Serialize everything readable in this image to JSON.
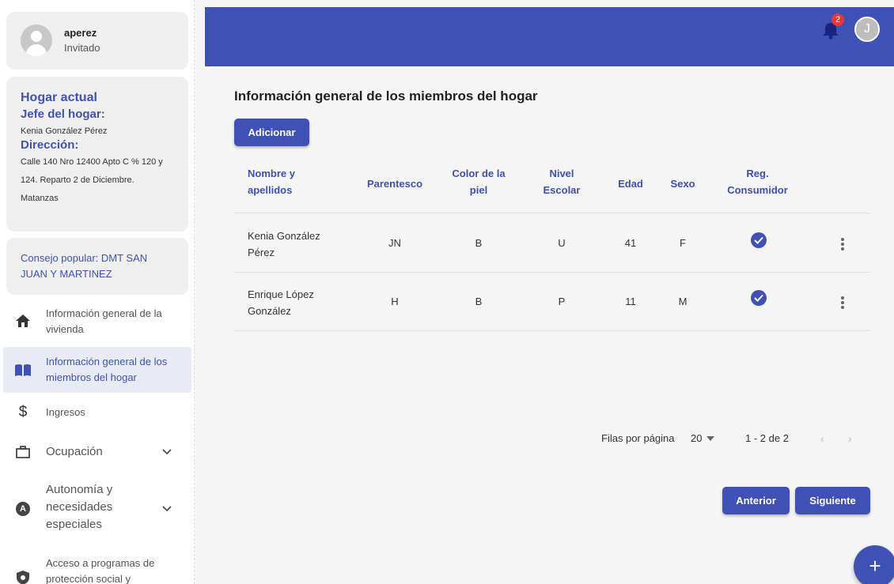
{
  "user": {
    "name": "aperez",
    "role": "Invitado"
  },
  "home": {
    "title": "Hogar actual",
    "jefe_label": "Jefe del hogar:",
    "jefe_value": "Kenia González Pérez",
    "direccion_label": "Dirección:",
    "direccion_line1": "Calle 140 Nro 12400 Apto C % 120 y",
    "direccion_line2": "124. Reparto 2 de Diciembre.",
    "direccion_line3": "Matanzas"
  },
  "consejo": {
    "line1": "Consejo popular: DMT SAN",
    "line2": "JUAN Y MARTINEZ"
  },
  "nav": {
    "vivienda": {
      "line1": "Información general de la",
      "line2": "vivienda"
    },
    "miembros": {
      "line1": "Información general de los",
      "line2": "miembros del hogar"
    },
    "ingresos": "Ingresos",
    "ocupacion": "Ocupación",
    "autonomia": {
      "line1": "Autonomía y",
      "line2": "necesidades",
      "line3": "especiales"
    },
    "acceso": {
      "line1": "Acceso a programas de",
      "line2": "protección social y"
    }
  },
  "header": {
    "notifications": "2",
    "avatar_letter": "J"
  },
  "main": {
    "title": "Información general de los miembros del hogar",
    "add_label": "Adicionar",
    "columns": {
      "nombre": {
        "line1": "Nombre y",
        "line2": "apellidos"
      },
      "parentesco": "Parentesco",
      "color": {
        "line1": "Color de la",
        "line2": "piel"
      },
      "nivel": {
        "line1": "Nivel",
        "line2": "Escolar"
      },
      "edad": "Edad",
      "sexo": "Sexo",
      "reg": {
        "line1": "Reg.",
        "line2": "Consumidor"
      }
    },
    "rows": [
      {
        "name1": "Kenia González",
        "name2": "Pérez",
        "parentesco": "JN",
        "color": "B",
        "nivel": "U",
        "edad": "41",
        "sexo": "F"
      },
      {
        "name1": "Enrique López",
        "name2": "González",
        "parentesco": "H",
        "color": "B",
        "nivel": "P",
        "edad": "11",
        "sexo": "M"
      }
    ],
    "pager": {
      "rows_label": "Filas por página",
      "rows_value": "20",
      "range": "1 - 2 de 2"
    },
    "prev_label": "Anterior",
    "next_label": "Siguiente"
  },
  "colors": {
    "accent": "#3f51b5",
    "badge": "#e53935"
  }
}
